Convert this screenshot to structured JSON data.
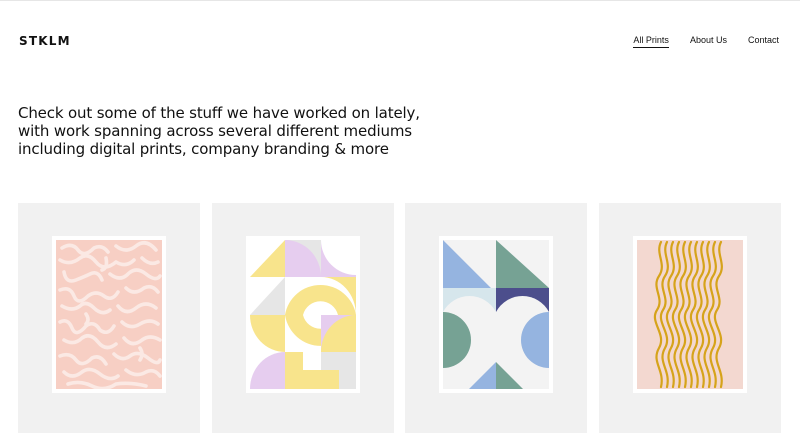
{
  "header": {
    "logo": "STKLM",
    "nav": [
      {
        "label": "All Prints",
        "active": true
      },
      {
        "label": "About Us",
        "active": false
      },
      {
        "label": "Contact",
        "active": false
      }
    ]
  },
  "intro": {
    "lines": [
      "Check out some of the stuff we have worked on lately,",
      "with work spanning across several different mediums",
      "including digital prints, company branding & more"
    ]
  },
  "prints": [
    {
      "name": "pink maze print",
      "colors": {
        "bg": "#f7cfc4",
        "line": "#fbe9e4"
      }
    },
    {
      "name": "pastel geometric print",
      "colors": {
        "yellow": "#f8e48c",
        "lilac": "#e6cdef",
        "grey": "#e6e6e6",
        "white": "#ffffff"
      }
    },
    {
      "name": "blue green geometric print",
      "colors": {
        "blue": "#95b4e0",
        "green": "#76a294",
        "navy": "#4c4e8c",
        "mist": "#d6e6ec",
        "offwhite": "#f3f3f3"
      }
    },
    {
      "name": "ochre wave print",
      "colors": {
        "bg": "#f3d8d0",
        "line": "#d6a31a"
      }
    }
  ]
}
